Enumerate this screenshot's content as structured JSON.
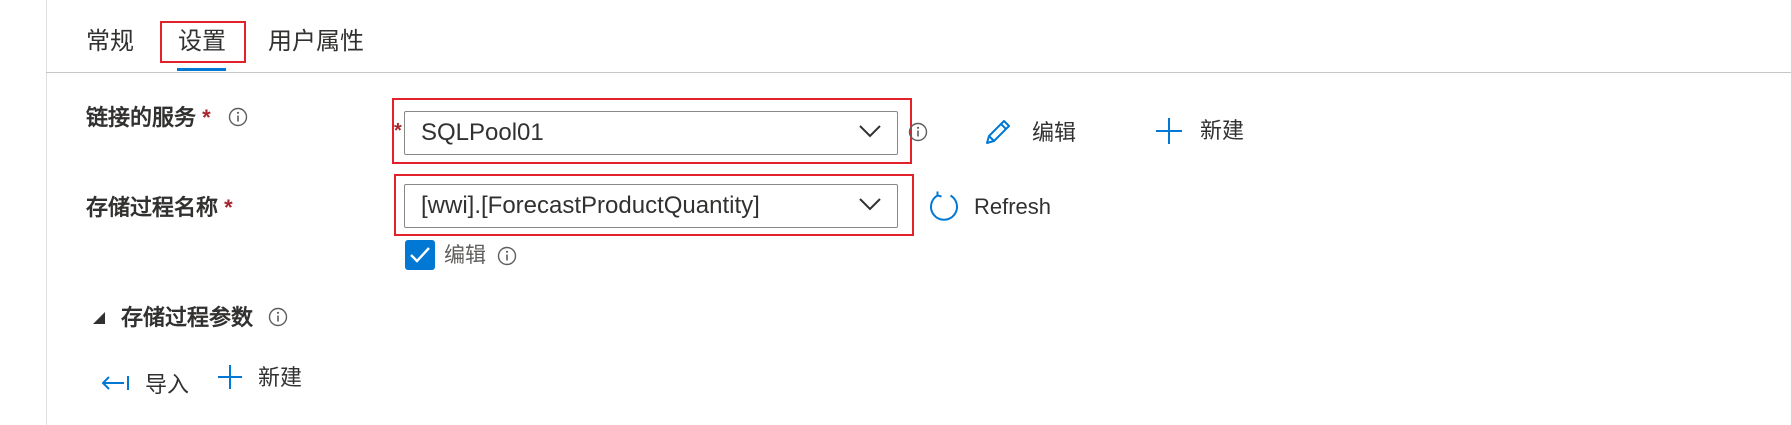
{
  "tabs": [
    {
      "label": "常规"
    },
    {
      "label": "设置"
    },
    {
      "label": "用户属性"
    }
  ],
  "linked_service": {
    "label": "链接的服务",
    "required_mark": "*",
    "field_required_mark": "*",
    "value": "SQLPool01",
    "edit_label": "编辑",
    "new_label": "新建"
  },
  "stored_procedure": {
    "label": "存储过程名称",
    "required_mark": "*",
    "value": "[wwi].[ForecastProductQuantity]",
    "refresh_label": "Refresh",
    "edit_checkbox_label": "编辑",
    "edit_checked": true
  },
  "params_section": {
    "title": "存储过程参数",
    "import_label": "导入",
    "new_label": "新建"
  },
  "colors": {
    "accent": "#0078d4",
    "highlight": "#e3212b",
    "required": "#a4262c"
  }
}
